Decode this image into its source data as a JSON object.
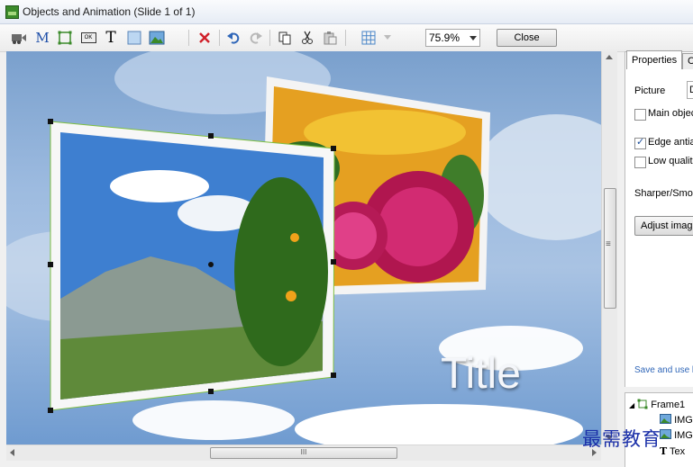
{
  "window": {
    "title": "Objects and Animation  (Slide 1 of 1)"
  },
  "toolbar": {
    "icons": [
      "video-icon",
      "mask-icon",
      "rectangle-icon",
      "button-icon",
      "text-icon",
      "blank-icon",
      "image-icon",
      "delete-icon",
      "undo-icon",
      "redo-icon",
      "copy-icon",
      "cut-icon",
      "paste-icon",
      "grid-icon"
    ],
    "mask_label": "M",
    "button_icon_label": "OK",
    "text_label": "T",
    "zoom_value": "75.9%",
    "close_label": "Close"
  },
  "canvas": {
    "title_text": "Title"
  },
  "scrollbars": {
    "grip": "III",
    "vgrip": "≡"
  },
  "properties": {
    "tabs": [
      "Properties",
      "Co"
    ],
    "picture_label": "Picture",
    "picture_value": "D",
    "main_object_label": "Main objec",
    "main_object_checked": false,
    "edge_antialiasing_label": "Edge antia",
    "edge_antialiasing_checked": true,
    "low_quality_label": "Low qualit",
    "low_quality_checked": false,
    "sharper_label": "Sharper/Smo",
    "adjust_button": "Adjust imag",
    "save_link": "Save and use b"
  },
  "tree": {
    "items": [
      {
        "label": "Frame1",
        "icon": "frame-icon"
      },
      {
        "label": "IMG",
        "icon": "image-icon"
      },
      {
        "label": "IMG",
        "icon": "image-icon"
      },
      {
        "label": "Tex",
        "icon": "text-icon"
      }
    ]
  },
  "watermark": "最需教育",
  "colors": {
    "accent": "#2f66b8",
    "selection": "#7fbf3f",
    "delete": "#d0202a"
  }
}
